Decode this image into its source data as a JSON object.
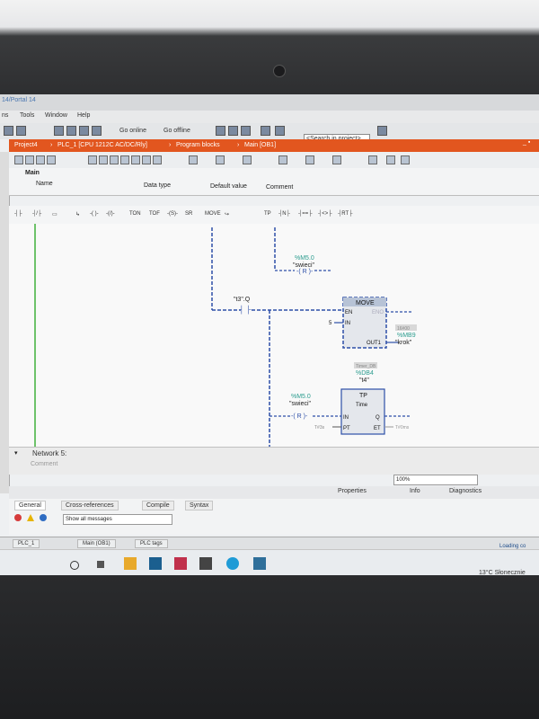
{
  "window": {
    "title": "14/Portal 14"
  },
  "menu": {
    "tools": "Tools",
    "window": "Window",
    "help": "Help",
    "left_fragment": "ns"
  },
  "toolbar": {
    "go_online": "Go online",
    "go_offline": "Go offline",
    "search_placeholder": "<Search in project>"
  },
  "breadcrumb": {
    "project": "Project4",
    "device": "PLC_1 [CPU 1212C AC/DC/Rly]",
    "program_blocks": "Program blocks",
    "main": "Main [OB1]"
  },
  "block_interface": {
    "title": "Main",
    "columns": [
      "Name",
      "Data type",
      "Default value",
      "Comment"
    ]
  },
  "ladder_toolbar": {
    "ton": "TON",
    "tof": "TOF",
    "move": "MOVE",
    "tp": "TP"
  },
  "network": {
    "coil1": {
      "address": "%M5.0",
      "tag": "\"swieci\"",
      "type": "R"
    },
    "contact": {
      "tag": "\"t3\".Q"
    },
    "move_block": {
      "name": "MOVE",
      "en": "EN",
      "eno": "ENO",
      "in": "IN",
      "in_value": "5",
      "out": "OUT1",
      "out_address": "%MB9",
      "out_tag": "\"krok\"",
      "out_value": "16#00"
    },
    "tp_block": {
      "db_address": "%DB4",
      "db_tag": "\"t4\"",
      "instance_label": "Timer_DB",
      "name": "TP",
      "type": "Time",
      "in": "IN",
      "pt": "PT",
      "q": "Q",
      "et": "ET",
      "pt_value": "T#3s",
      "et_value": "T#0ms"
    },
    "coil2": {
      "address": "%M5.0",
      "tag": "\"swieci\"",
      "type": "R"
    }
  },
  "network5": {
    "title": "Network 5:",
    "comment": "Comment"
  },
  "zoom": "100%",
  "properties_tabs": {
    "properties": "Properties",
    "info": "Info",
    "diagnostics": "Diagnostics"
  },
  "inspector_tabs": {
    "general": "General",
    "cross_references": "Cross-references",
    "compile": "Compile",
    "syntax": "Syntax"
  },
  "messages_filter": "Show all messages",
  "portal_tasks": {
    "plc": "PLC_1",
    "main": "Main (OB1)",
    "tags": "PLC tags"
  },
  "status": {
    "loading": "Loading co"
  },
  "taskbar": {
    "weather": "13°C Słonecznie"
  },
  "colors": {
    "breadcrumb": "#e2561f",
    "rail": "#6ec26a",
    "wire": "#2d4fa8",
    "address": "#2a9c8e"
  }
}
